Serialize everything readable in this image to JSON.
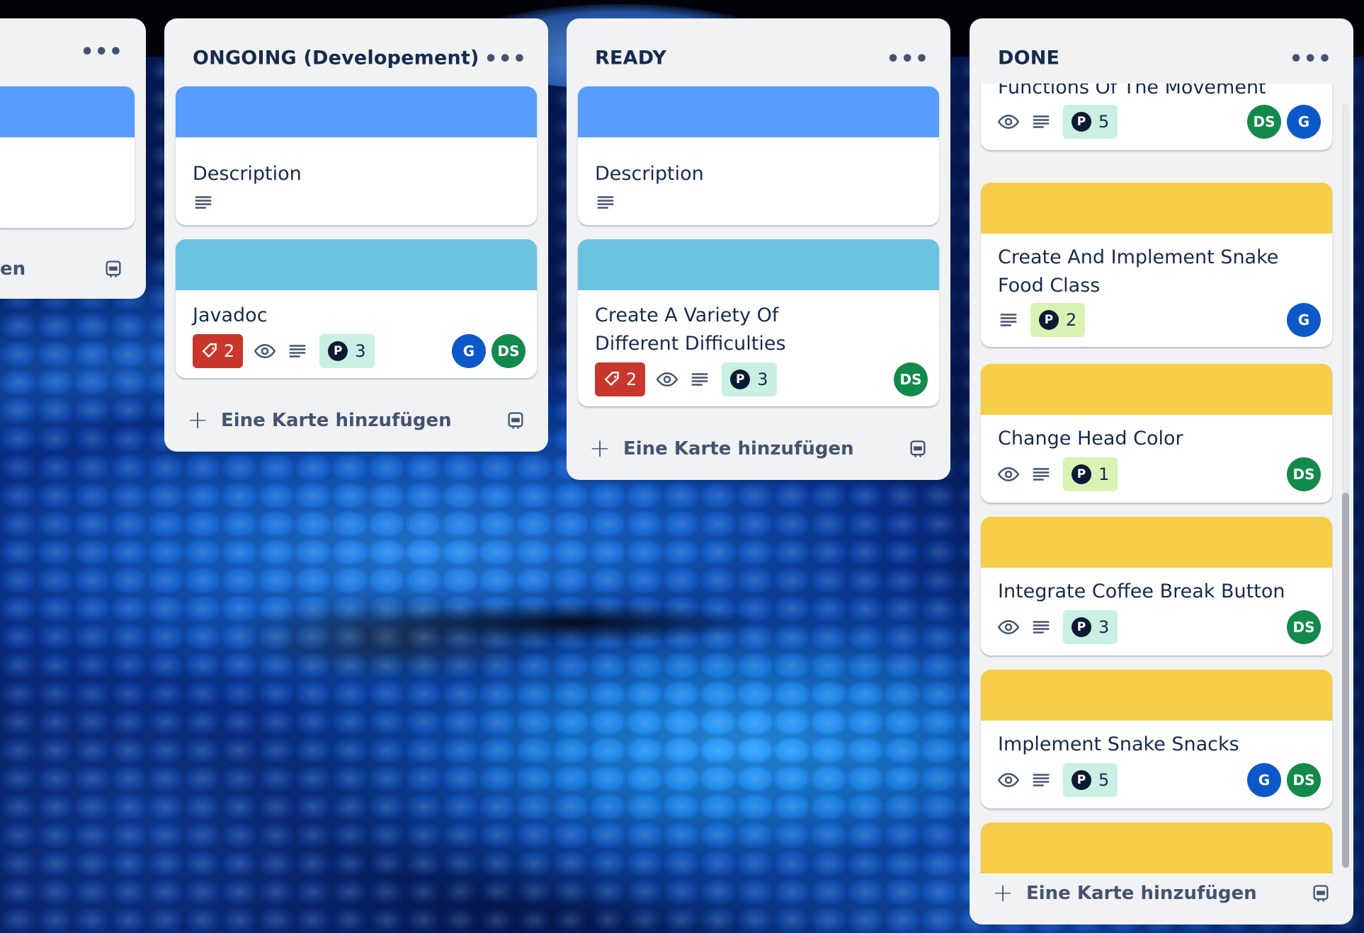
{
  "board": {
    "lists": [
      {
        "title": "",
        "footer_partial_label": "en"
      },
      {
        "title": "ONGOING (Developement)",
        "menu": "•••",
        "add_label": "Eine Karte hinzufügen",
        "cards": [
          {
            "title": "Description",
            "cover_color": "#579dff"
          },
          {
            "title": "Javadoc",
            "cover_color": "#6cc3e0",
            "due_count": "2",
            "points": "3",
            "members": [
              "G",
              "DS"
            ]
          }
        ]
      },
      {
        "title": "READY",
        "menu": "•••",
        "add_label": "Eine Karte hinzufügen",
        "cards": [
          {
            "title": "Description",
            "cover_color": "#579dff"
          },
          {
            "title": "Create A Variety Of Different Difficulties",
            "cover_color": "#6cc3e0",
            "due_count": "2",
            "points": "3",
            "members": [
              "DS"
            ]
          }
        ]
      },
      {
        "title": "DONE",
        "menu": "•••",
        "add_label": "Eine Karte hinzufügen",
        "cards": [
          {
            "title": "Functions Of The Movement",
            "points": "5",
            "members": [
              "DS",
              "G"
            ]
          },
          {
            "title": "Create And Implement Snake Food Class",
            "cover_color": "#f5cd47",
            "points": "2",
            "members": [
              "G"
            ]
          },
          {
            "title": "Change Head Color",
            "cover_color": "#f5cd47",
            "points": "1",
            "members": [
              "DS"
            ]
          },
          {
            "title": "Integrate Coffee Break Button",
            "cover_color": "#f5cd47",
            "points": "3",
            "members": [
              "DS"
            ]
          },
          {
            "title": "Implement Snake Snacks",
            "cover_color": "#f5cd47",
            "points": "5",
            "members": [
              "G",
              "DS"
            ]
          }
        ]
      }
    ],
    "points_letter": "P",
    "colors": {
      "list_bg": "#f1f2f4",
      "due_red": "#c9372c",
      "avatar_g": "#0c58c8",
      "avatar_ds": "#138a4c",
      "points_teal": "#c9f0e2",
      "points_lime": "#d8f3b4"
    }
  }
}
